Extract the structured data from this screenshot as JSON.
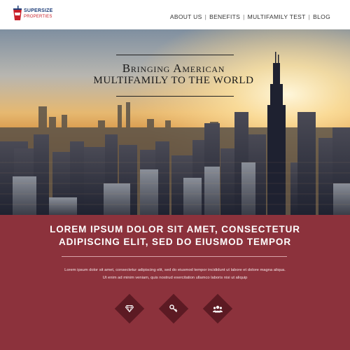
{
  "header": {
    "logo": {
      "line1": "SUPERSIZE",
      "line2": "PROPERTIES"
    },
    "nav": [
      {
        "label": "ABOUT US"
      },
      {
        "label": "BENEFITS"
      },
      {
        "label": "MULTIFAMILY TEST"
      },
      {
        "label": "BLOG"
      }
    ]
  },
  "hero": {
    "title_line1": "Bringing American",
    "title_line2": "MULTIFAMILY TO THE WORLD"
  },
  "band": {
    "heading_line1": "LOREM IPSUM DOLOR SIT AMET, CONSECTETUR",
    "heading_line2": "ADIPISCING ELIT, SED DO EIUSMOD TEMPOR",
    "body_line1": "Lorem ipsum dolor sit amet, consectetur adipiscing elit, sed do eiusmod tempor incididunt ut labore et dolore magna aliqua.",
    "body_line2": "Ut enim ad minim veniam, quis nostrud exercitation ullamco laboris nisi ut aliquip",
    "icons": [
      "diamond-icon",
      "key-icon",
      "users-icon"
    ]
  },
  "colors": {
    "band": "#8c323c",
    "diamond": "#5c1a23",
    "logo_blue": "#1f3f7a",
    "logo_red": "#c8202a"
  }
}
